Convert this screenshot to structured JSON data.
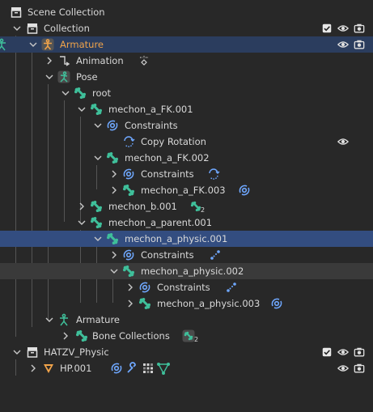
{
  "outliner": {
    "rows": [
      {
        "label": "Scene Collection"
      },
      {
        "label": "Collection"
      },
      {
        "label": "Armature"
      },
      {
        "label": "Animation"
      },
      {
        "label": "Pose"
      },
      {
        "label": "root"
      },
      {
        "label": "mechon_a_FK.001"
      },
      {
        "label": "Constraints"
      },
      {
        "label": "Copy Rotation"
      },
      {
        "label": "mechon_a_FK.002"
      },
      {
        "label": "Constraints"
      },
      {
        "label": "mechon_a_FK.003"
      },
      {
        "label": "mechon_b.001"
      },
      {
        "label": "mechon_a_parent.001"
      },
      {
        "label": "mechon_a_physic.001"
      },
      {
        "label": "Constraints"
      },
      {
        "label": "mechon_a_physic.002"
      },
      {
        "label": "Constraints"
      },
      {
        "label": "mechon_a_physic.003"
      },
      {
        "label": "Armature"
      },
      {
        "label": "Bone Collections"
      },
      {
        "label": "HATZV_Physic"
      },
      {
        "label": "HP.001"
      }
    ],
    "badges": {
      "bone_child_count": "2",
      "bone_collections_count": "2"
    },
    "icons": {
      "visibility": "eye-icon",
      "render": "camera-icon",
      "exclude": "checkbox-icon",
      "bone": "bone-icon",
      "constraint": "constraint-icon",
      "armature": "armature-icon",
      "collection": "collection-icon",
      "mesh": "mesh-icon"
    },
    "colors": {
      "background": "#282828",
      "selection": "#334d80",
      "hover": "#3a3a3a",
      "active_object": "#f0a34a",
      "bone": "#3fbf9a",
      "constraint": "#6fa8ff",
      "mesh": "#f0a34a"
    }
  }
}
